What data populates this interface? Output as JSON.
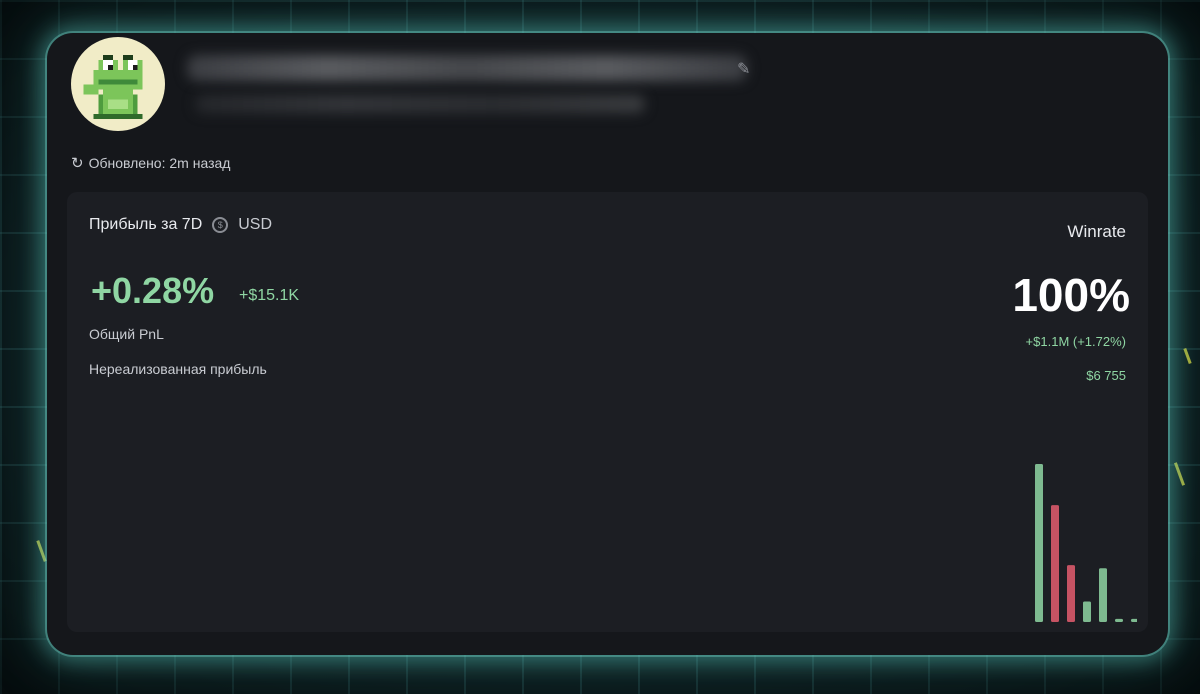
{
  "profile": {
    "avatar_icon": "pixel-frog-icon",
    "edit_icon": "pencil-icon"
  },
  "status": {
    "refresh_icon": "refresh-icon",
    "updated_text": "Обновлено: 2m назад"
  },
  "pnl_panel": {
    "title": "Прибыль за 7D",
    "currency_icon": "coin-icon",
    "currency": "USD",
    "pnl_percent": "+0.28%",
    "pnl_amount": "+$15.1K",
    "total_pnl_label": "Общий PnL",
    "unrealized_label": "Нереализованная прибыль"
  },
  "winrate": {
    "label": "Winrate",
    "value": "100%",
    "total_pnl": "+$1.1M (+1.72%)",
    "unrealized": "$6 755"
  },
  "colors": {
    "positive": "#8fd6a3",
    "negative": "#d9596a",
    "card_bg": "#15171b",
    "panel_bg": "#1c1e23"
  },
  "distribution_bars": [
    {
      "value": 1.0,
      "color": "positive"
    },
    {
      "value": 0.74,
      "color": "negative"
    },
    {
      "value": 0.36,
      "color": "negative"
    },
    {
      "value": 0.13,
      "color": "positive"
    },
    {
      "value": 0.34,
      "color": "positive"
    },
    {
      "value": 0.02,
      "color": "positive"
    },
    {
      "value": 0.02,
      "color": "positive"
    }
  ]
}
